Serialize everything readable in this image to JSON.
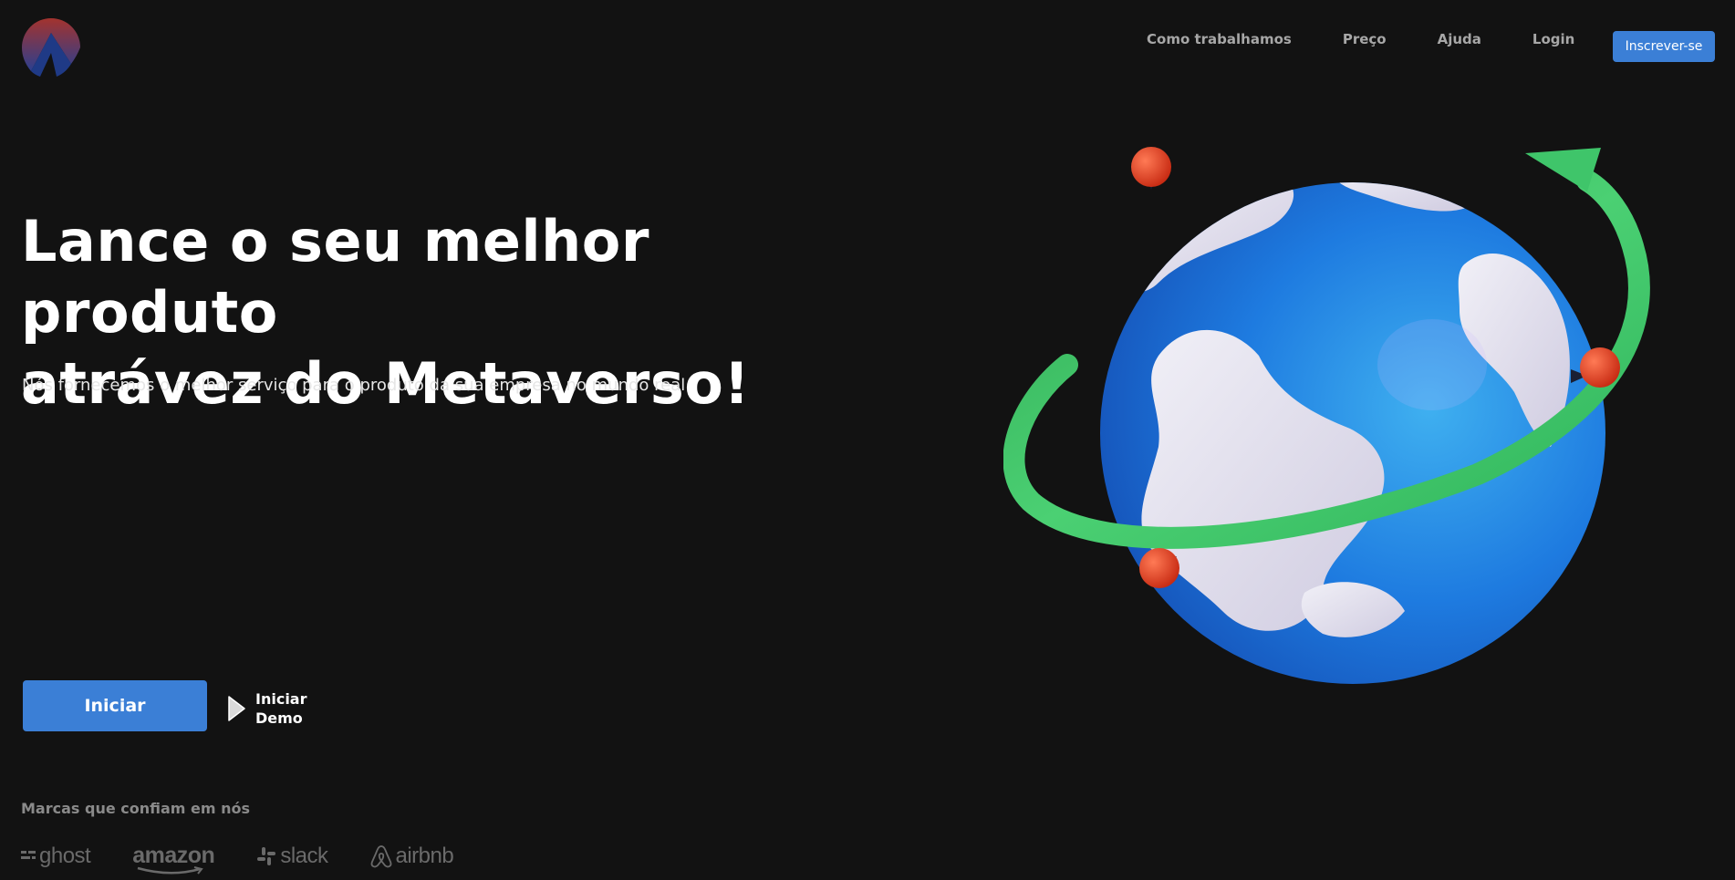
{
  "header": {
    "logo_name": "logo-icon",
    "nav": [
      {
        "label": "Como trabalhamos"
      },
      {
        "label": "Preço"
      },
      {
        "label": "Ajuda"
      },
      {
        "label": "Login"
      }
    ],
    "signup_label": "Inscrever-se"
  },
  "hero": {
    "title_line1": "Lance o seu melhor produto",
    "title_line2": "atrávez do Metaverso!",
    "subtitle": "Nós fornecemos o melhor serviço para o produto da sua empresa no mundo real",
    "start_label": "Iniciar",
    "demo_label": "Iniciar Demo",
    "illustration": "globe-with-orbit-arrow-and-pins"
  },
  "brands": {
    "title": "Marcas que confiam em nós",
    "items": [
      {
        "name": "ghost",
        "icon": "ghost-icon"
      },
      {
        "name": "amazon",
        "icon": "amazon-logo"
      },
      {
        "name": "slack",
        "icon": "slack-icon"
      },
      {
        "name": "airbnb",
        "icon": "airbnb-icon"
      }
    ]
  },
  "colors": {
    "background": "#121212",
    "primary": "#3b7fd6",
    "nav_text": "#a7a7a7",
    "muted": "#6a6a6a",
    "globe_blue": "#1e7be0",
    "land": "#e4e2ef",
    "orbit_green": "#3fc56a",
    "pin_red": "#e23a1f"
  }
}
